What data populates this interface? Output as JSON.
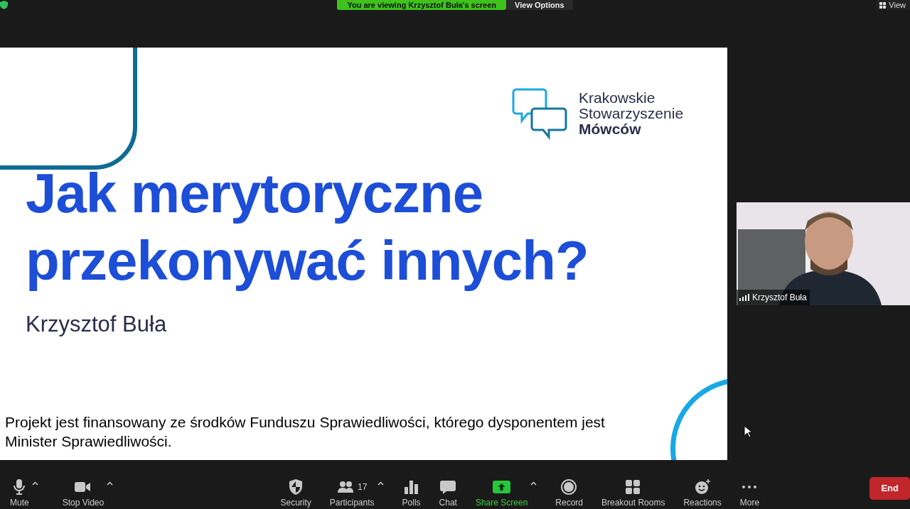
{
  "top_bar": {
    "banner": "You are viewing Krzysztof Buła's screen",
    "view_options": "View Options",
    "view_button": "View"
  },
  "slide": {
    "logo_lines": [
      "Krakowskie",
      "Stowarzyszenie",
      "Mówców"
    ],
    "title_lines": [
      "Jak merytoryczne",
      "przekonywać innych?"
    ],
    "presenter": "Krzysztof Buła",
    "footer": "Projekt jest finansowany ze środków Funduszu Sprawiedliwości, którego dysponentem jest Minister Sprawiedliwości."
  },
  "video_tile": {
    "kind": "picture",
    "name": "Krzysztof Buła"
  },
  "toolbar": {
    "left": [
      {
        "kind": "mute",
        "label": "Mute",
        "menu": true
      },
      {
        "kind": "video",
        "label": "Stop Video",
        "menu": true
      }
    ],
    "center": [
      {
        "kind": "security",
        "label": "Security",
        "menu": false
      },
      {
        "kind": "participants",
        "label": "Participants",
        "count": "17",
        "menu": true
      },
      {
        "kind": "polls",
        "label": "Polls",
        "menu": false
      },
      {
        "kind": "chat",
        "label": "Chat",
        "menu": false
      },
      {
        "kind": "share",
        "label": "Share Screen",
        "menu": true
      },
      {
        "kind": "record",
        "label": "Record",
        "menu": false
      },
      {
        "kind": "breakout",
        "label": "Breakout Rooms",
        "menu": false
      },
      {
        "kind": "reactions",
        "label": "Reactions",
        "menu": false
      },
      {
        "kind": "more",
        "label": "More",
        "menu": false
      }
    ],
    "end": "End"
  }
}
